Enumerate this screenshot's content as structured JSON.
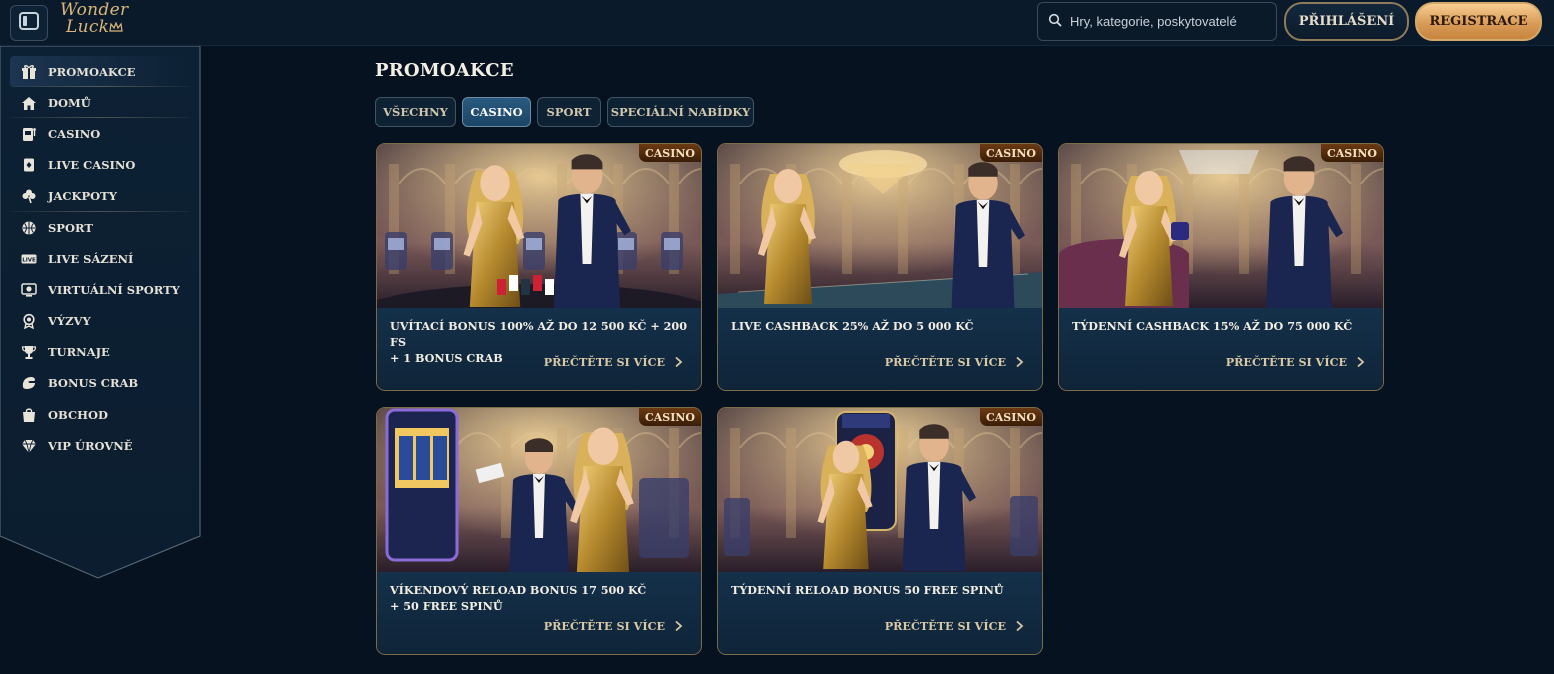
{
  "header": {
    "logo_line1": "Wonder",
    "logo_line2": "Luck",
    "search_placeholder": "Hry, kategorie, poskytovatelé",
    "login_label": "PŘIHLÁŠENÍ",
    "register_label": "REGISTRACE"
  },
  "sidebar": {
    "items": [
      {
        "label": "PROMOAKCE",
        "icon": "gift-icon",
        "active": true
      },
      {
        "label": "DOMŮ",
        "icon": "home-icon"
      },
      {
        "label": "CASINO",
        "icon": "slot-machine-icon"
      },
      {
        "label": "LIVE CASINO",
        "icon": "playing-card-icon"
      },
      {
        "label": "JACKPOTY",
        "icon": "clover-icon"
      },
      {
        "label": "SPORT",
        "icon": "ball-icon"
      },
      {
        "label": "LIVE SÁZENÍ",
        "icon": "live-icon"
      },
      {
        "label": "VIRTUÁLNÍ SPORTY",
        "icon": "virtual-sport-icon"
      },
      {
        "label": "VÝZVY",
        "icon": "challenge-badge-icon"
      },
      {
        "label": "TURNAJE",
        "icon": "trophy-icon"
      },
      {
        "label": "BONUS CRAB",
        "icon": "crab-claw-icon"
      },
      {
        "label": "OBCHOD",
        "icon": "shopping-bag-icon"
      },
      {
        "label": "VIP ÚROVNĚ",
        "icon": "diamond-icon"
      }
    ]
  },
  "main": {
    "title": "PROMOAKCE",
    "tabs": [
      {
        "label": "VŠECHNY"
      },
      {
        "label": "CASINO",
        "active": true
      },
      {
        "label": "SPORT"
      },
      {
        "label": "SPECIÁLNÍ NABÍDKY"
      }
    ],
    "cards": [
      {
        "badge": "CASINO",
        "title_line1": "UVÍTACÍ BONUS 100% AŽ DO 12 500 KČ + 200 FS",
        "title_line2": "+ 1 BONUS CRAB",
        "more": "PŘEČTĚTE SI VÍCE",
        "scene": "casino-lounge-couple"
      },
      {
        "badge": "CASINO",
        "title_line1": "LIVE CASHBACK 25% AŽ DO 5 000 KČ",
        "title_line2": "",
        "more": "PŘEČTĚTE SI VÍCE",
        "scene": "roulette-table-couple"
      },
      {
        "badge": "CASINO",
        "title_line1": "TÝDENNÍ CASHBACK 15% AŽ DO 75 000 KČ",
        "title_line2": "",
        "more": "PŘEČTĚTE SI VÍCE",
        "scene": "sofa-gift-couple"
      },
      {
        "badge": "CASINO",
        "title_line1": "VÍKENDOVÝ RELOAD BONUS 17 500 KČ",
        "title_line2": "+ 50 FREE SPINŮ",
        "more": "PŘEČTĚTE SI VÍCE",
        "scene": "slot-machine-couple"
      },
      {
        "badge": "CASINO",
        "title_line1": "TÝDENNÍ RELOAD BONUS 50 FREE SPINŮ",
        "title_line2": "",
        "more": "PŘEČTĚTE SI VÍCE",
        "scene": "reload-wheel-couple"
      }
    ]
  },
  "colors": {
    "background": "#06121f",
    "gold": "#d9b77a",
    "accent_blue": "#2a5a80"
  }
}
